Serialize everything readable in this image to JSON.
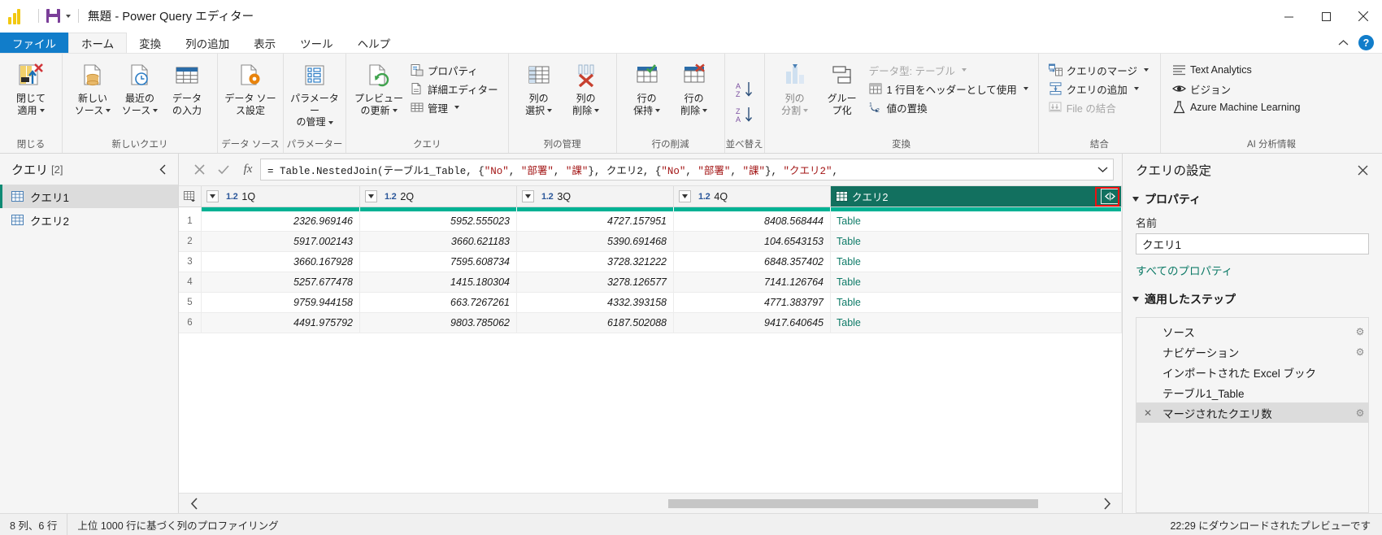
{
  "titlebar": {
    "app_icon": "powerbi-logo",
    "save_icon": "save-icon",
    "quick_access_caret": "chevron-down-icon",
    "title": "無題 - Power Query エディター",
    "minimize": "minimize-icon",
    "maximize": "maximize-icon",
    "close": "close-icon"
  },
  "ribbon": {
    "tabs": [
      {
        "label": "ファイル",
        "state": "file"
      },
      {
        "label": "ホーム",
        "state": "active"
      },
      {
        "label": "変換",
        "state": "normal"
      },
      {
        "label": "列の追加",
        "state": "normal"
      },
      {
        "label": "表示",
        "state": "normal"
      },
      {
        "label": "ツール",
        "state": "normal"
      },
      {
        "label": "ヘルプ",
        "state": "normal"
      }
    ],
    "collapse_icon": "chevron-up-icon",
    "help_icon": "help-question-icon",
    "groups": [
      {
        "label": "閉じる",
        "big_buttons": [
          {
            "line1": "閉じて",
            "line2": "適用",
            "caret": true,
            "icon": "close-and-apply-icon"
          }
        ]
      },
      {
        "label": "新しいクエリ",
        "big_buttons": [
          {
            "line1": "新しい",
            "line2": "ソース",
            "caret": true,
            "icon": "new-source-icon"
          },
          {
            "line1": "最近の",
            "line2": "ソース",
            "caret": true,
            "icon": "recent-sources-icon"
          },
          {
            "line1": "データ",
            "line2": "の入力",
            "caret": false,
            "icon": "enter-data-icon"
          }
        ]
      },
      {
        "label": "データ ソース",
        "big_buttons": [
          {
            "line1": "データ ソー",
            "line2": "ス設定",
            "caret": false,
            "icon": "data-source-settings-icon"
          }
        ]
      },
      {
        "label": "パラメーター",
        "big_buttons": [
          {
            "line1": "パラメーター",
            "line2": "の管理",
            "caret": true,
            "icon": "manage-parameters-icon"
          }
        ]
      },
      {
        "label": "クエリ",
        "big_buttons": [
          {
            "line1": "プレビュー",
            "line2": "の更新",
            "caret": true,
            "icon": "refresh-preview-icon"
          }
        ],
        "small_buttons": [
          {
            "label": "プロパティ",
            "icon": "properties-icon",
            "caret": false,
            "disabled": false
          },
          {
            "label": "詳細エディター",
            "icon": "advanced-editor-icon",
            "caret": false,
            "disabled": false
          },
          {
            "label": "管理",
            "icon": "manage-icon",
            "caret": true,
            "disabled": false
          }
        ]
      },
      {
        "label": "列の管理",
        "big_buttons": [
          {
            "line1": "列の",
            "line2": "選択",
            "caret": true,
            "icon": "choose-columns-icon"
          },
          {
            "line1": "列の",
            "line2": "削除",
            "caret": true,
            "icon": "remove-columns-icon"
          }
        ]
      },
      {
        "label": "行の削減",
        "big_buttons": [
          {
            "line1": "行の",
            "line2": "保持",
            "caret": true,
            "icon": "keep-rows-icon"
          },
          {
            "line1": "行の",
            "line2": "削除",
            "caret": true,
            "icon": "remove-rows-icon"
          }
        ]
      },
      {
        "label": "並べ替え",
        "big_buttons": [
          {
            "line1": "",
            "line2": "",
            "caret": false,
            "icon": "sort-ascending-icon"
          }
        ]
      },
      {
        "label": "変換",
        "big_buttons": [
          {
            "line1": "列の",
            "line2": "分割",
            "caret": true,
            "icon": "split-column-icon",
            "dim": true
          },
          {
            "line1": "グルー",
            "line2": "プ化",
            "caret": false,
            "icon": "group-by-icon"
          }
        ],
        "small_buttons": [
          {
            "label": "データ型: テーブル",
            "icon": "data-type-icon",
            "caret": true,
            "disabled": true
          },
          {
            "label": "1 行目をヘッダーとして使用",
            "icon": "use-first-row-header-icon",
            "caret": true,
            "disabled": false
          },
          {
            "label": "値の置換",
            "icon": "replace-values-icon",
            "caret": false,
            "disabled": false
          }
        ]
      },
      {
        "label": "結合",
        "small_buttons": [
          {
            "label": "クエリのマージ",
            "icon": "merge-queries-icon",
            "caret": true,
            "disabled": false
          },
          {
            "label": "クエリの追加",
            "icon": "append-queries-icon",
            "caret": true,
            "disabled": false
          },
          {
            "label": "File の結合",
            "icon": "combine-files-icon",
            "caret": false,
            "disabled": true
          }
        ]
      },
      {
        "label": "AI 分析情報",
        "small_buttons": [
          {
            "label": "Text Analytics",
            "icon": "text-analytics-icon",
            "caret": false,
            "disabled": false
          },
          {
            "label": "ビジョン",
            "icon": "vision-eye-icon",
            "caret": false,
            "disabled": false
          },
          {
            "label": "Azure Machine Learning",
            "icon": "azure-ml-flask-icon",
            "caret": false,
            "disabled": false
          }
        ]
      }
    ]
  },
  "queries_pane": {
    "title": "クエリ",
    "count": "[2]",
    "collapse_icon": "chevron-left-icon",
    "items": [
      {
        "label": "クエリ1",
        "icon": "table-icon",
        "selected": true
      },
      {
        "label": "クエリ2",
        "icon": "table-icon",
        "selected": false
      }
    ]
  },
  "formula_bar": {
    "cancel_icon": "cancel-x-icon",
    "accept_icon": "accept-check-icon",
    "fx_icon": "fx-icon",
    "prefix": "= Table.NestedJoin(テーブル1_Table, {",
    "text": "= Table.NestedJoin(テーブル1_Table, {\"No\", \"部署\", \"課\"}, クエリ2, {\"No\", \"部署\", \"課\"}, \"クエリ2\",",
    "expand_icon": "chevron-down-icon",
    "segments": [
      {
        "t": "= Table.NestedJoin(テーブル1_Table, {",
        "c": "k"
      },
      {
        "t": "\"No\"",
        "c": "s"
      },
      {
        "t": ", ",
        "c": "k"
      },
      {
        "t": "\"部署\"",
        "c": "s"
      },
      {
        "t": ", ",
        "c": "k"
      },
      {
        "t": "\"課\"",
        "c": "s"
      },
      {
        "t": "}, クエリ2, {",
        "c": "k"
      },
      {
        "t": "\"No\"",
        "c": "s"
      },
      {
        "t": ", ",
        "c": "k"
      },
      {
        "t": "\"部署\"",
        "c": "s"
      },
      {
        "t": ", ",
        "c": "k"
      },
      {
        "t": "\"課\"",
        "c": "s"
      },
      {
        "t": "}, ",
        "c": "k"
      },
      {
        "t": "\"クエリ2\"",
        "c": "s"
      },
      {
        "t": ",",
        "c": "k"
      }
    ]
  },
  "grid": {
    "columns": [
      {
        "type": "1.2",
        "name": "1Q",
        "selected": false,
        "filter_icon": "filter-dropdown-icon"
      },
      {
        "type": "1.2",
        "name": "2Q",
        "selected": false,
        "filter_icon": "filter-dropdown-icon"
      },
      {
        "type": "1.2",
        "name": "3Q",
        "selected": false,
        "filter_icon": "filter-dropdown-icon"
      },
      {
        "type": "1.2",
        "name": "4Q",
        "selected": false,
        "filter_icon": "filter-dropdown-icon"
      },
      {
        "type": "table",
        "name": "クエリ2",
        "selected": true,
        "expand_icon": "expand-columns-icon"
      }
    ],
    "rows": [
      {
        "n": "1",
        "cells": [
          "2326.969146",
          "5952.555023",
          "4727.157951",
          "8408.568444",
          "Table"
        ]
      },
      {
        "n": "2",
        "cells": [
          "5917.002143",
          "3660.621183",
          "5390.691468",
          "104.6543153",
          "Table"
        ]
      },
      {
        "n": "3",
        "cells": [
          "3660.167928",
          "7595.608734",
          "3728.321222",
          "6848.357402",
          "Table"
        ]
      },
      {
        "n": "4",
        "cells": [
          "5257.677478",
          "1415.180304",
          "3278.126577",
          "7141.126764",
          "Table"
        ]
      },
      {
        "n": "5",
        "cells": [
          "9759.944158",
          "663.7267261",
          "4332.393158",
          "4771.383797",
          "Table"
        ]
      },
      {
        "n": "6",
        "cells": [
          "4491.975792",
          "9803.785062",
          "6187.502088",
          "9417.640645",
          "Table"
        ]
      }
    ],
    "scroll_left_icon": "chevron-left-icon",
    "scroll_right_icon": "chevron-right-icon"
  },
  "settings_pane": {
    "title": "クエリの設定",
    "close_icon": "close-icon",
    "properties_section": {
      "label": "プロパティ",
      "name_label": "名前",
      "name_value": "クエリ1",
      "all_properties_link": "すべてのプロパティ"
    },
    "steps_section": {
      "label": "適用したステップ",
      "steps": [
        {
          "label": "ソース",
          "gear": true,
          "delete": false,
          "selected": false
        },
        {
          "label": "ナビゲーション",
          "gear": true,
          "delete": false,
          "selected": false
        },
        {
          "label": "インポートされた Excel ブック",
          "gear": false,
          "delete": false,
          "selected": false
        },
        {
          "label": "テーブル1_Table",
          "gear": false,
          "delete": false,
          "selected": false
        },
        {
          "label": "マージされたクエリ数",
          "gear": true,
          "delete": true,
          "selected": true
        }
      ]
    }
  },
  "statusbar": {
    "left": "8 列、6 行",
    "middle": "上位 1000 行に基づく列のプロファイリング",
    "right": "22:29 にダウンロードされたプレビューです"
  },
  "colors": {
    "accent_teal": "#12705f",
    "quality_bar": "#00b294",
    "file_tab_blue": "#117dca",
    "highlight_red": "#ee1111",
    "link_teal": "#0f7b68",
    "brand_yellow": "#f2c811"
  }
}
